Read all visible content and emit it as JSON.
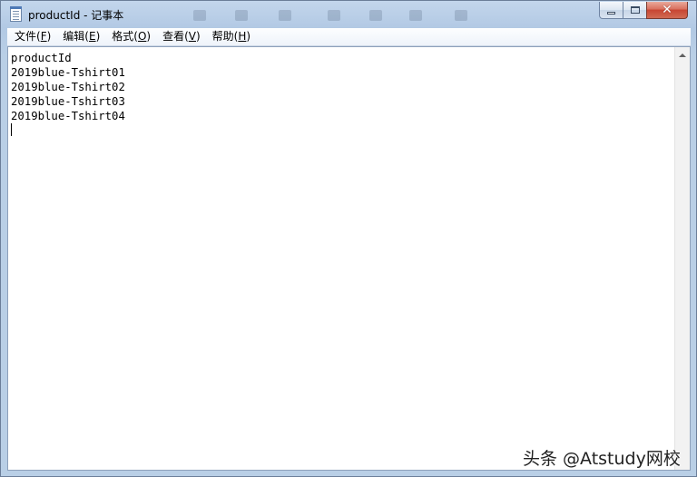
{
  "window": {
    "title": "productId - 记事本"
  },
  "menu": [
    {
      "label": "文件(",
      "accel": "F",
      "suffix": ")"
    },
    {
      "label": "编辑(",
      "accel": "E",
      "suffix": ")"
    },
    {
      "label": "格式(",
      "accel": "O",
      "suffix": ")"
    },
    {
      "label": "查看(",
      "accel": "V",
      "suffix": ")"
    },
    {
      "label": "帮助(",
      "accel": "H",
      "suffix": ")"
    }
  ],
  "document": {
    "lines": [
      "productId",
      "2019blue-Tshirt01",
      "2019blue-Tshirt02",
      "2019blue-Tshirt03",
      "2019blue-Tshirt04"
    ]
  },
  "watermark": "头条 @Atstudy网校",
  "icons": {
    "app": "notepad-icon",
    "minimize": "minimize-icon",
    "maximize": "maximize-icon",
    "close": "close-icon",
    "scroll_up": "scroll-up-arrow-icon"
  }
}
